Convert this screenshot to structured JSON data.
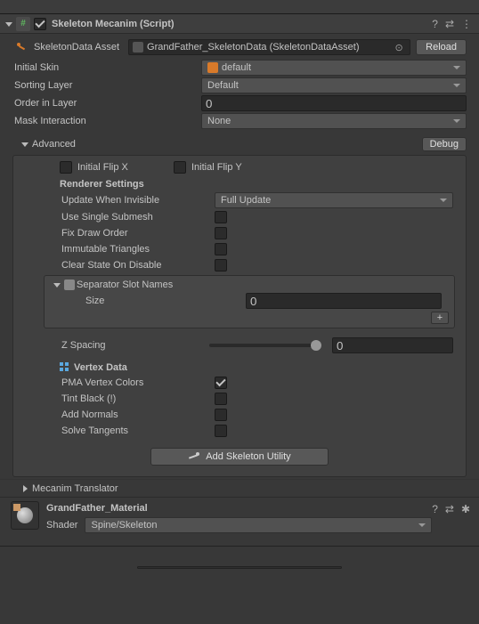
{
  "component": {
    "title": "Skeleton Mecanim (Script)",
    "enabled": true
  },
  "skeletonData": {
    "label": "SkeletonData Asset",
    "value": "GrandFather_SkeletonData (SkeletonDataAsset)",
    "reload": "Reload"
  },
  "fields": {
    "initialSkin": {
      "label": "Initial Skin",
      "value": "default"
    },
    "sortingLayer": {
      "label": "Sorting Layer",
      "value": "Default"
    },
    "orderInLayer": {
      "label": "Order in Layer",
      "value": "0"
    },
    "maskInteraction": {
      "label": "Mask Interaction",
      "value": "None"
    }
  },
  "advanced": {
    "label": "Advanced",
    "debug": "Debug",
    "initialFlipX": "Initial Flip X",
    "initialFlipY": "Initial Flip Y",
    "rendererSettings": "Renderer Settings",
    "updateWhenInvisible": {
      "label": "Update When Invisible",
      "value": "Full Update"
    },
    "useSingleSubmesh": "Use Single Submesh",
    "fixDrawOrder": "Fix Draw Order",
    "immutableTriangles": "Immutable Triangles",
    "clearStateOnDisable": "Clear State On Disable",
    "separator": {
      "label": "Separator Slot Names",
      "sizeLabel": "Size",
      "sizeValue": "0"
    },
    "zSpacing": {
      "label": "Z Spacing",
      "value": "0"
    },
    "vertexData": {
      "label": "Vertex Data",
      "pma": "PMA Vertex Colors",
      "tintBlack": "Tint Black (!)",
      "addNormals": "Add Normals",
      "solveTangents": "Solve Tangents"
    },
    "addSkeletonUtility": "Add Skeleton Utility"
  },
  "mecanimTranslator": "Mecanim Translator",
  "material": {
    "name": "GrandFather_Material",
    "shaderLabel": "Shader",
    "shaderValue": "Spine/Skeleton"
  }
}
